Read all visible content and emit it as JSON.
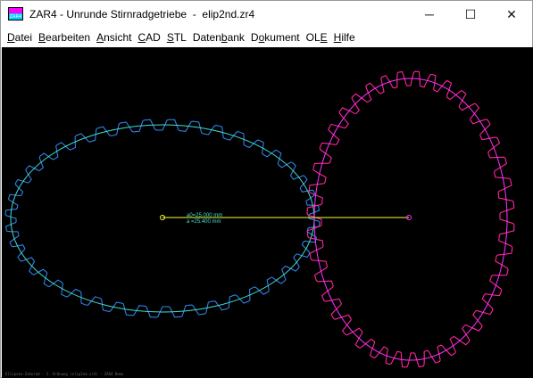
{
  "window": {
    "title": "ZAR4 - Unrunde Stirnradgetriebe  -  elip2nd.zr4",
    "app_icon_text": "ZAR4"
  },
  "controls": {
    "minimize": "─",
    "maximize": "☐",
    "close": "✕"
  },
  "menu": [
    {
      "pre": "",
      "ul": "D",
      "post": "atei"
    },
    {
      "pre": "",
      "ul": "B",
      "post": "earbeiten"
    },
    {
      "pre": "",
      "ul": "A",
      "post": "nsicht"
    },
    {
      "pre": "",
      "ul": "C",
      "post": "AD"
    },
    {
      "pre": "",
      "ul": "S",
      "post": "TL"
    },
    {
      "pre": "Daten",
      "ul": "b",
      "post": "ank"
    },
    {
      "pre": "D",
      "ul": "o",
      "post": "kument"
    },
    {
      "pre": "OL",
      "ul": "E",
      "post": ""
    },
    {
      "pre": "",
      "ul": "H",
      "post": "ilfe"
    }
  ],
  "drawing": {
    "center_distance_label": "a0=25.000 mm",
    "actual_distance_label": "a =25.400 mm",
    "status": "Ellipsen-Zahnrad - 2. Ordnung  (elip2nd.zr4)  -  ZAR4 Demo",
    "colors": {
      "gear1_pitch": "#40e0d0",
      "gear1_teeth": "#2222ff",
      "gear2_pitch": "#ff33ff",
      "gear2_teeth": "#ff1a3c",
      "center_line": "#ffff33",
      "label": "#40e0d0"
    },
    "gear1": {
      "teeth": 40
    },
    "gear2": {
      "teeth": 40
    }
  }
}
